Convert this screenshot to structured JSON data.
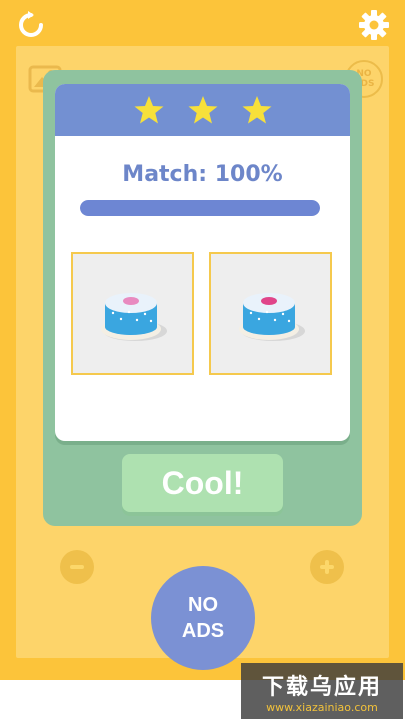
{
  "top_bar": {
    "refresh_icon": "refresh-icon",
    "settings_icon": "gear-icon",
    "no_ads_small_line1": "NO",
    "no_ads_small_line2": "ADS"
  },
  "dialog": {
    "stars": 3,
    "match_text": "Match: 100%",
    "match_progress": 1.0,
    "cool_label": "Cool!"
  },
  "bottom": {
    "minus_icon": "minus-icon",
    "plus_icon": "plus-icon",
    "no_ads_line1": "NO",
    "no_ads_line2": "ADS"
  },
  "watermark": {
    "main": "下载乌应用",
    "url": "www.xiazainiao.com"
  },
  "colors": {
    "background": "#fcc43a",
    "dialog": "#8fc39f",
    "header": "#7390d2",
    "accent": "#6d86c9",
    "star": "#f7e03a",
    "button": "#aee1b0"
  }
}
